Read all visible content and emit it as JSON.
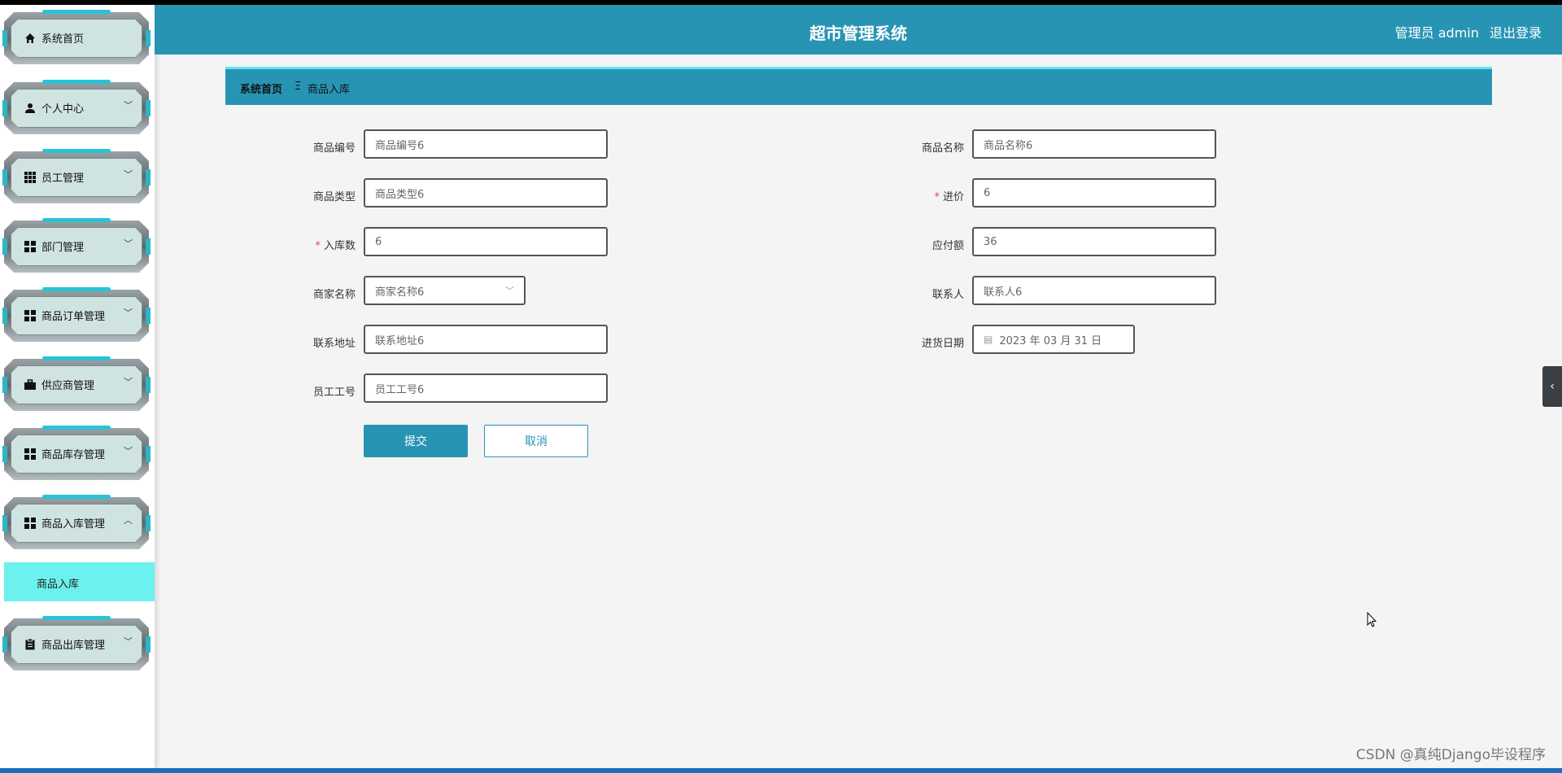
{
  "header": {
    "title": "超市管理系统",
    "user_label": "管理员 admin",
    "logout_label": "退出登录"
  },
  "sidebar": {
    "items": [
      {
        "label": "系统首页",
        "icon": "home-icon"
      },
      {
        "label": "个人中心",
        "icon": "user-icon"
      },
      {
        "label": "员工管理",
        "icon": "grid-icon"
      },
      {
        "label": "部门管理",
        "icon": "grid-icon"
      },
      {
        "label": "商品订单管理",
        "icon": "grid-icon"
      },
      {
        "label": "供应商管理",
        "icon": "briefcase-icon"
      },
      {
        "label": "商品库存管理",
        "icon": "grid-icon"
      },
      {
        "label": "商品入库管理",
        "icon": "grid-icon"
      },
      {
        "label": "商品出库管理",
        "icon": "clipboard-icon"
      }
    ],
    "active_sub": "商品入库"
  },
  "breadcrumb": {
    "home": "系统首页",
    "separator": "Ξ",
    "current": "商品入库"
  },
  "form": {
    "product_code": {
      "label": "商品编号",
      "value": "商品编号6"
    },
    "product_name": {
      "label": "商品名称",
      "value": "商品名称6"
    },
    "product_type": {
      "label": "商品类型",
      "value": "商品类型6"
    },
    "purchase_price": {
      "label": "进价",
      "value": "6",
      "required": true
    },
    "stock_in_qty": {
      "label": "入库数",
      "value": "6",
      "required": true
    },
    "amount_payable": {
      "label": "应付额",
      "value": "36"
    },
    "merchant_name": {
      "label": "商家名称",
      "value": "商家名称6"
    },
    "contact_person": {
      "label": "联系人",
      "value": "联系人6"
    },
    "contact_address": {
      "label": "联系地址",
      "value": "联系地址6"
    },
    "purchase_date": {
      "label": "进货日期",
      "value": "2023 年 03 月 31 日"
    },
    "employee_id": {
      "label": "员工工号",
      "value": "员工工号6"
    },
    "required_mark": "*"
  },
  "buttons": {
    "submit": "提交",
    "cancel": "取消"
  },
  "watermark": "CSDN @真纯Django毕设程序",
  "colors": {
    "primary": "#2894b3",
    "submenu_active": "#6cf1ee",
    "required": "#e34d4d"
  }
}
